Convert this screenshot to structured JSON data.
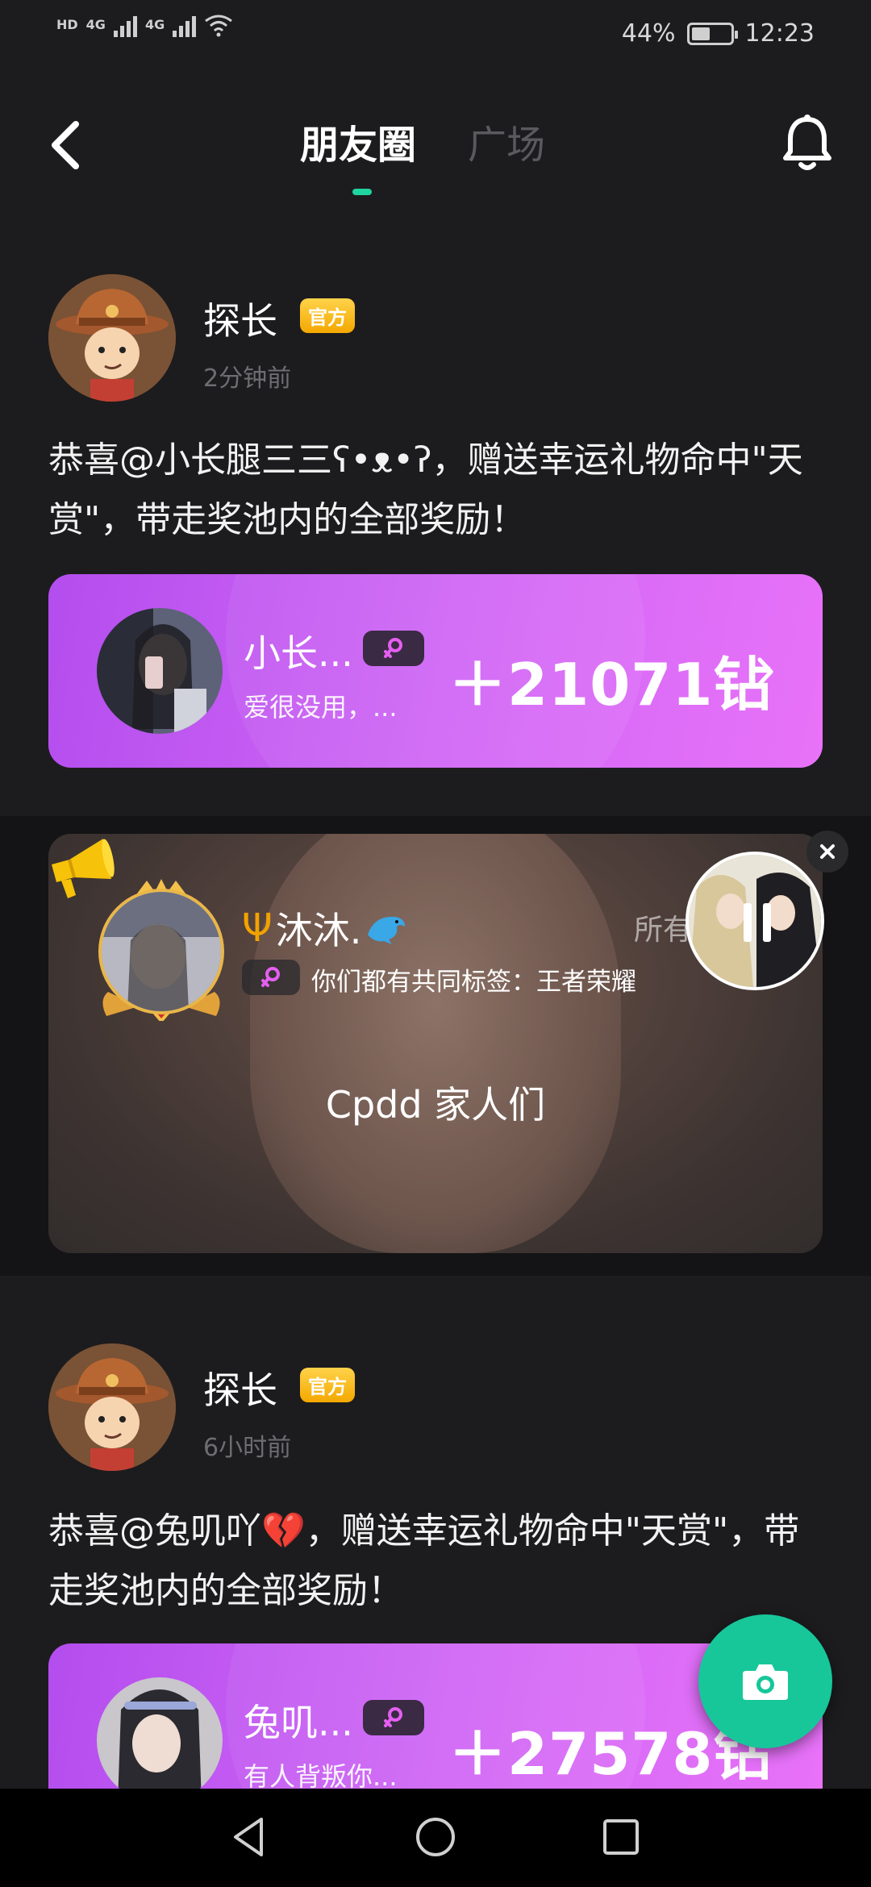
{
  "status_bar": {
    "network_labels": [
      "HD",
      "4G",
      "4G"
    ],
    "battery_percent": "44%",
    "time": "12:23"
  },
  "nav": {
    "tabs": [
      {
        "label": "朋友圈",
        "active": true
      },
      {
        "label": "广场",
        "active": false
      }
    ]
  },
  "posts": [
    {
      "author": "探长",
      "badge": "官方",
      "time": "2分钟前",
      "text": "恭喜@小长腿三三ʕ•ᴥ•ʔ，赠送幸运礼物命中\"天赏\"，带走奖池内的全部奖励！",
      "gift_card": {
        "user_name": "小长...",
        "signature": "爱很没用，...",
        "amount": "＋21071钻"
      }
    },
    {
      "author": "探长",
      "badge": "官方",
      "time": "6小时前",
      "text": "恭喜@兔叽吖💔，赠送幸运礼物命中\"天赏\"，带走奖池内的全部奖励！",
      "gift_card": {
        "user_name": "兔叽...",
        "signature": "有人背叛你...",
        "amount": "＋27578钻"
      }
    }
  ],
  "live": {
    "name": "沐沐.",
    "right_text": "所有",
    "tag_text": "你们都有共同标签：王者荣耀",
    "caption": "Cpdd 家人们"
  },
  "colors": {
    "background": "#1c1c1e",
    "accent": "#1fd4a0",
    "gift_card_gradient_start": "#b44dee",
    "gift_card_gradient_end": "#e872f8",
    "official_badge": "#f4a800",
    "fab": "#17c79a"
  },
  "icons": {
    "back": "chevron-left-icon",
    "bell": "bell-icon",
    "camera": "camera-icon",
    "speaker": "megaphone-icon",
    "close": "close-icon",
    "pause": "pause-icon"
  }
}
